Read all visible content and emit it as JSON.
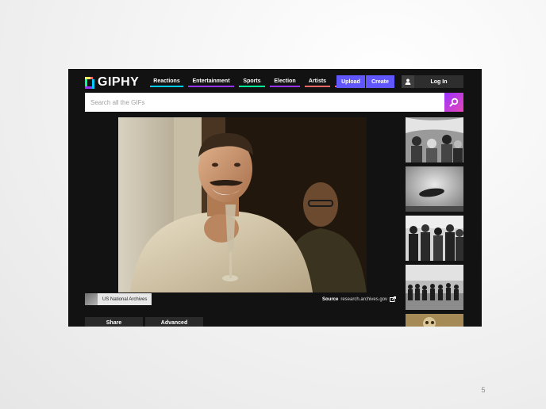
{
  "app": {
    "logo_text": "GIPHY"
  },
  "nav": {
    "items": [
      {
        "label": "Reactions",
        "color": "#00ccff"
      },
      {
        "label": "Entertainment",
        "color": "#9933ff"
      },
      {
        "label": "Sports",
        "color": "#00ff99"
      },
      {
        "label": "Election",
        "color": "#9933ff"
      },
      {
        "label": "Artists",
        "color": "#ff6666"
      }
    ],
    "more_label": "⋮"
  },
  "header": {
    "upload_label": "Upload",
    "create_label": "Create",
    "login_label": "Log In",
    "accent_color": "#6157ff"
  },
  "search": {
    "placeholder": "Search all the GIFs",
    "value": ""
  },
  "gif": {
    "icon": "main-gif-image"
  },
  "attribution": {
    "user_name": "US National Archives",
    "source_label": "Source",
    "source_url": "research.archives.gov"
  },
  "actions": {
    "share_label": "Share",
    "advanced_label": "Advanced"
  },
  "slide": {
    "number": "5"
  }
}
